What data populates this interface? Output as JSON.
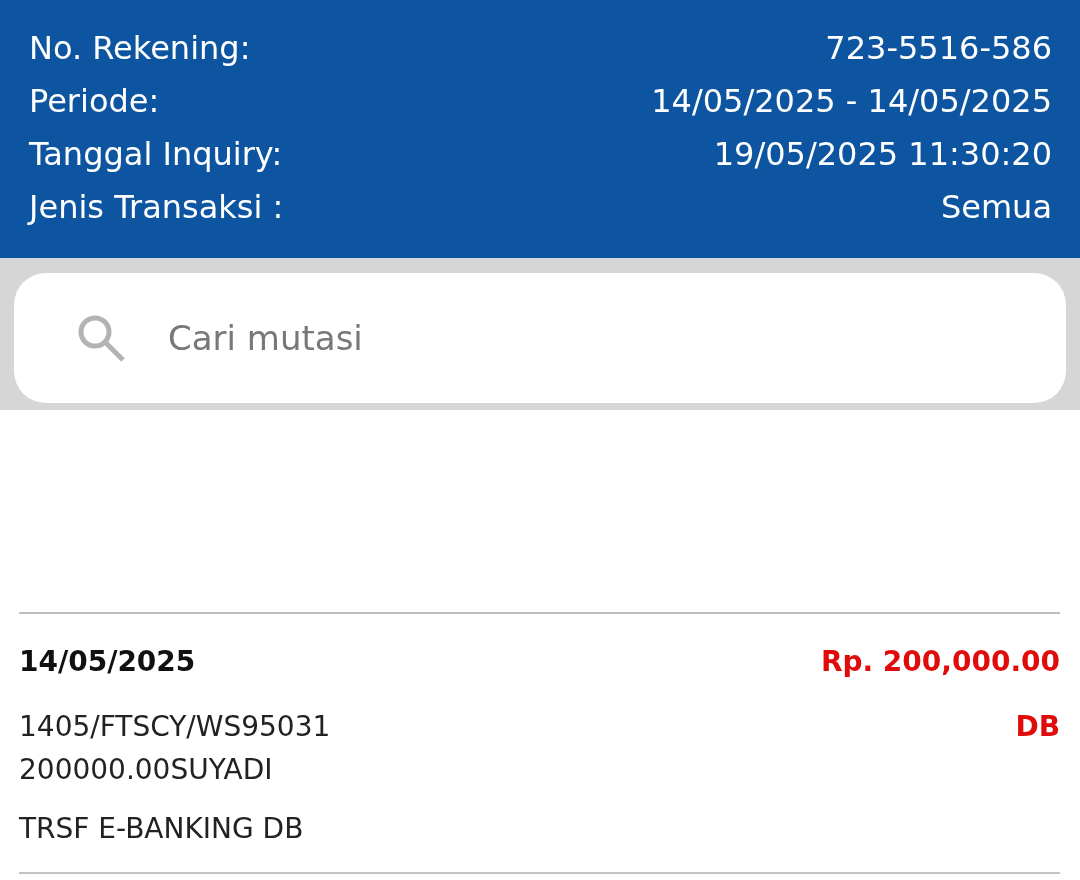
{
  "header": {
    "fields": [
      {
        "label": "No. Rekening:",
        "value": "723-5516-586"
      },
      {
        "label": "Periode:",
        "value": "14/05/2025 - 14/05/2025"
      },
      {
        "label": "Tanggal Inquiry:",
        "value": "19/05/2025 11:30:20"
      },
      {
        "label": "Jenis Transaksi :",
        "value": "Semua"
      }
    ]
  },
  "search": {
    "placeholder": "Cari mutasi"
  },
  "transactions": [
    {
      "kind": "debit",
      "date": "14/05/2025",
      "amount": "Rp. 200,000.00",
      "description": [
        "1405/FTSCY/WS95031",
        "200000.00SUYADI"
      ],
      "type": "DB",
      "remark": "TRSF E-BANKING DB"
    }
  ]
}
